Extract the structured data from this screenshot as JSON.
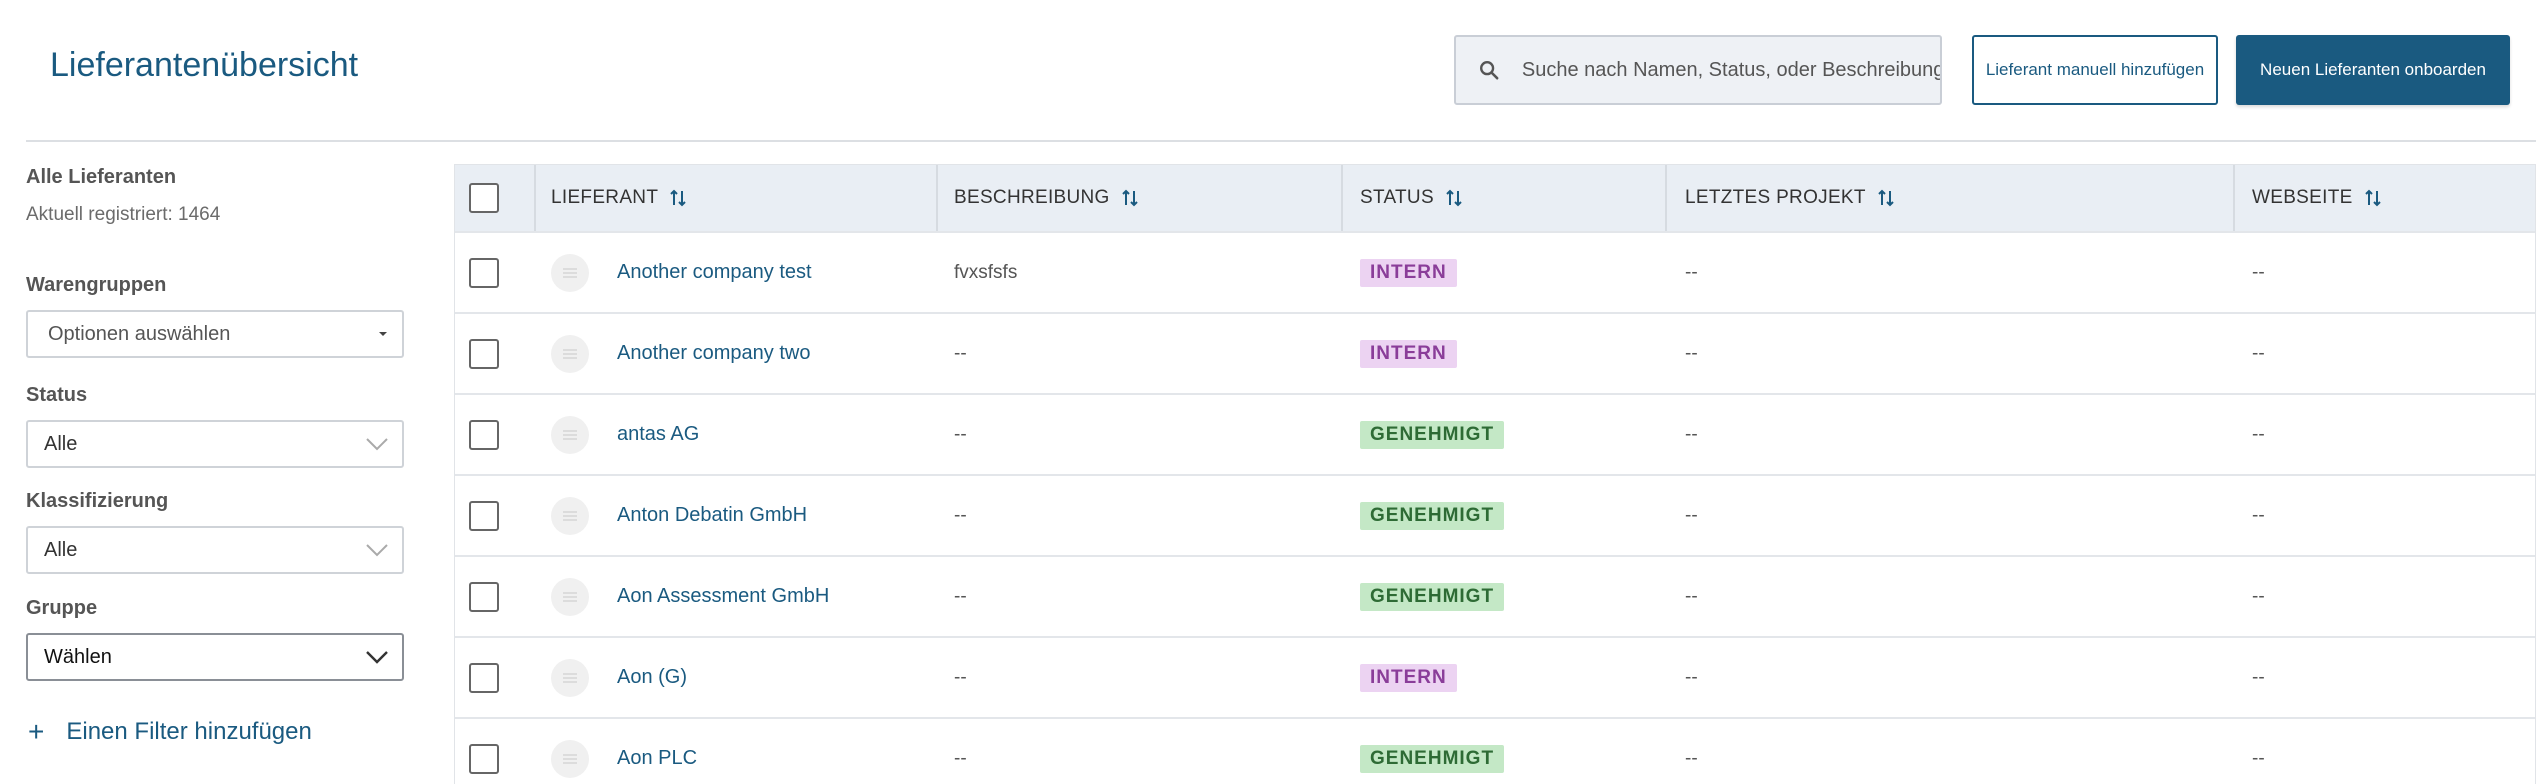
{
  "header": {
    "title": "Lieferantenübersicht",
    "search_placeholder": "Suche nach Namen, Status, oder Beschreibung",
    "add_manual_label": "Lieferant manuell hinzufügen",
    "onboard_label": "Neuen Lieferanten onboarden"
  },
  "sidebar": {
    "all_suppliers_heading": "Alle Lieferanten",
    "registered_text": "Aktuell registriert: 1464",
    "product_groups_label": "Warengruppen",
    "product_groups_value": "Optionen auswählen",
    "status_label": "Status",
    "status_value": "Alle",
    "classification_label": "Klassifizierung",
    "classification_value": "Alle",
    "group_label": "Gruppe",
    "group_value": "Wählen",
    "add_filter_label": "Einen Filter hinzufügen",
    "add_filter_icon": "+"
  },
  "table": {
    "columns": [
      "LIEFERANT",
      "BESCHREIBUNG",
      "STATUS",
      "LETZTES PROJEKT",
      "WEBSEITE"
    ],
    "rows": [
      {
        "name": "Another company test",
        "description": "fvxsfsfs",
        "status": "INTERN",
        "last_project": "--",
        "website": "--"
      },
      {
        "name": "Another company two",
        "description": "--",
        "status": "INTERN",
        "last_project": "--",
        "website": "--"
      },
      {
        "name": "antas AG",
        "description": "--",
        "status": "GENEHMIGT",
        "last_project": "--",
        "website": "--"
      },
      {
        "name": "Anton Debatin GmbH",
        "description": "--",
        "status": "GENEHMIGT",
        "last_project": "--",
        "website": "--"
      },
      {
        "name": "Aon Assessment GmbH",
        "description": "--",
        "status": "GENEHMIGT",
        "last_project": "--",
        "website": "--"
      },
      {
        "name": "Aon (G)",
        "description": "--",
        "status": "INTERN",
        "last_project": "--",
        "website": "--"
      },
      {
        "name": "Aon PLC",
        "description": "--",
        "status": "GENEHMIGT",
        "last_project": "--",
        "website": "--"
      }
    ]
  },
  "colors": {
    "brand": "#1a5a80",
    "intern_bg": "#ecd3f2",
    "intern_text": "#8a3d99",
    "approved_bg": "#c4e8c6",
    "approved_text": "#2e6b35",
    "header_bg": "#e9eef4"
  }
}
